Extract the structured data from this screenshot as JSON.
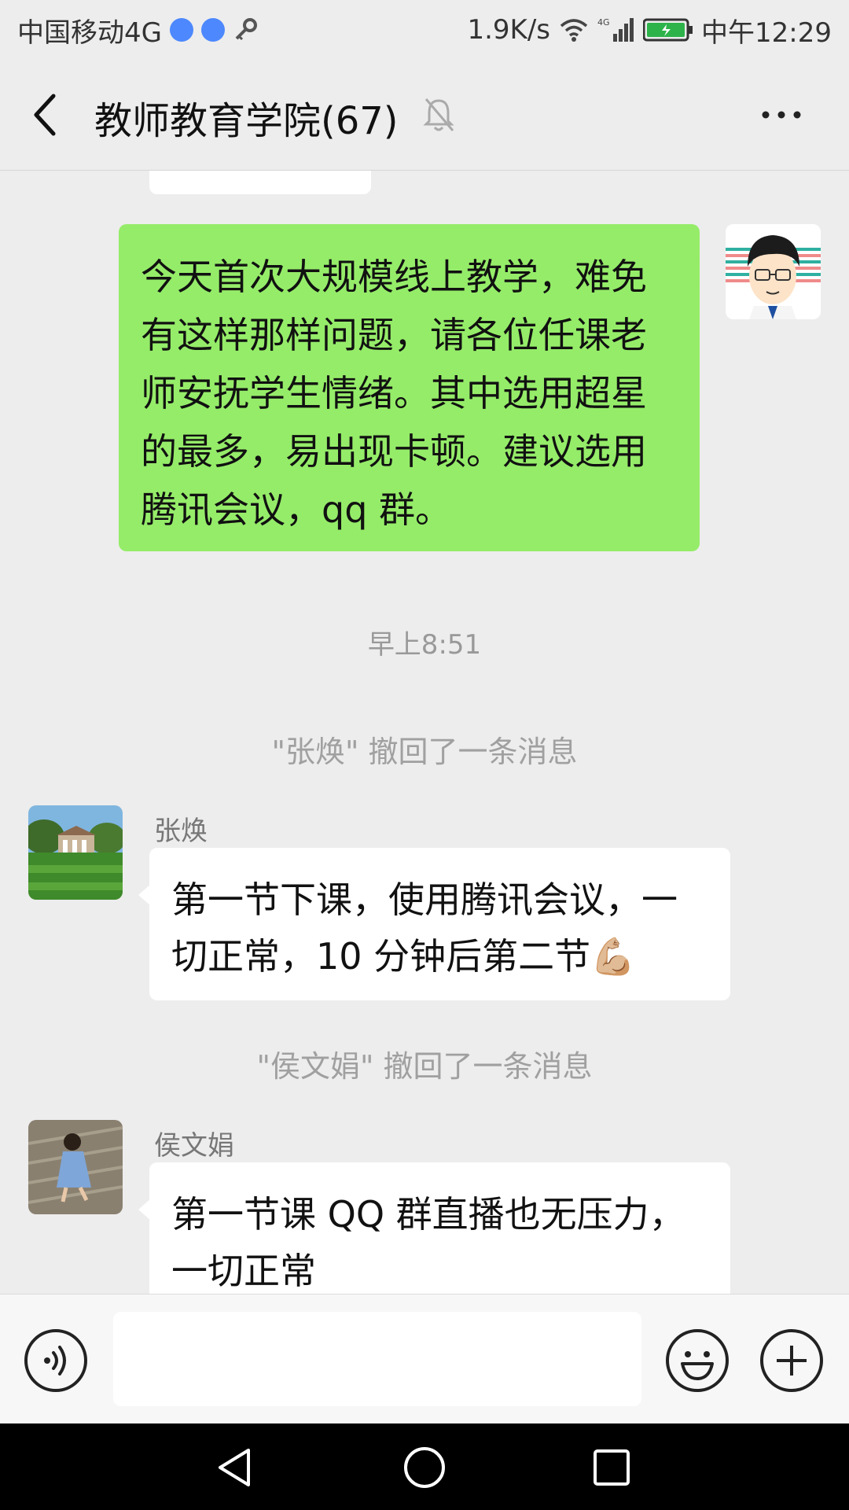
{
  "status_bar": {
    "carrier": "中国移动4G",
    "speed": "1.9K/s",
    "network": "4G",
    "time": "中午12:29"
  },
  "header": {
    "title": "教师教育学院(67)"
  },
  "messages": {
    "outgoing_text": "今天首次大规模线上教学，难免有这样那样问题，请各位任课老师安抚学生情绪。其中选用超星的最多，易出现卡顿。建议选用腾讯会议，qq 群。",
    "time_label": "早上8:51",
    "recall_1": "\"张焕\" 撤回了一条消息",
    "sender_1": "张焕",
    "text_1": "第一节下课，使用腾讯会议，一切正常，10 分钟后第二节💪🏼",
    "recall_2": "\"侯文娟\" 撤回了一条消息",
    "sender_2": "侯文娟",
    "text_2": "第一节课 QQ 群直播也无压力，一切正常"
  },
  "colors": {
    "self_bubble": "#95ec69",
    "background": "#ededed"
  }
}
